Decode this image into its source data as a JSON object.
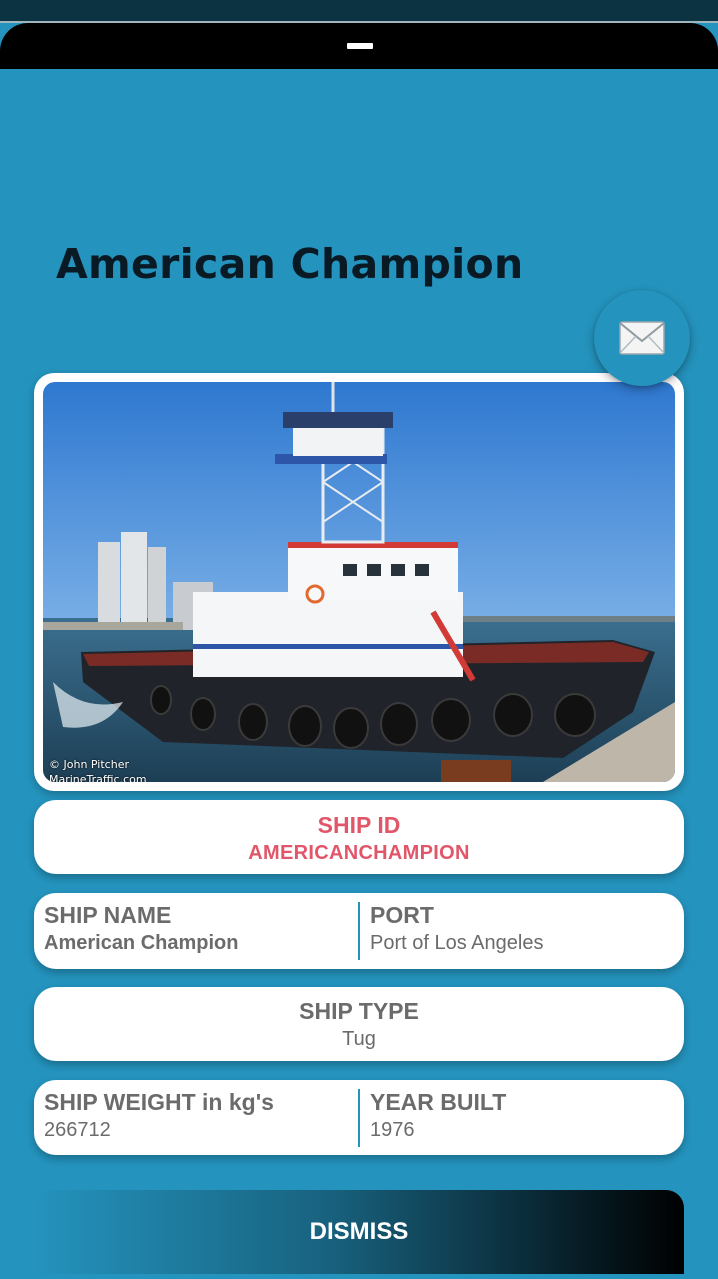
{
  "ship": {
    "title": "American Champion",
    "id_label": "SHIP ID",
    "id_value": "AMERICANCHAMPION",
    "name_label": "SHIP NAME",
    "name_value": "American Champion",
    "port_label": "PORT",
    "port_value": "Port of Los Angeles",
    "type_label": "SHIP TYPE",
    "type_value": "Tug",
    "weight_label": "SHIP WEIGHT in kg's",
    "weight_value": "266712",
    "year_label": "YEAR BUILT",
    "year_value": "1976"
  },
  "photo": {
    "credit_line1": "© John Pitcher",
    "credit_line2": "MarineTraffic.com"
  },
  "actions": {
    "dismiss_label": "DISMISS",
    "mail_icon": "envelope-icon"
  },
  "colors": {
    "background": "#2493bd",
    "accent_red": "#e2566a",
    "label_gray": "#6b6b6b",
    "title_dark": "#0a1a24"
  }
}
